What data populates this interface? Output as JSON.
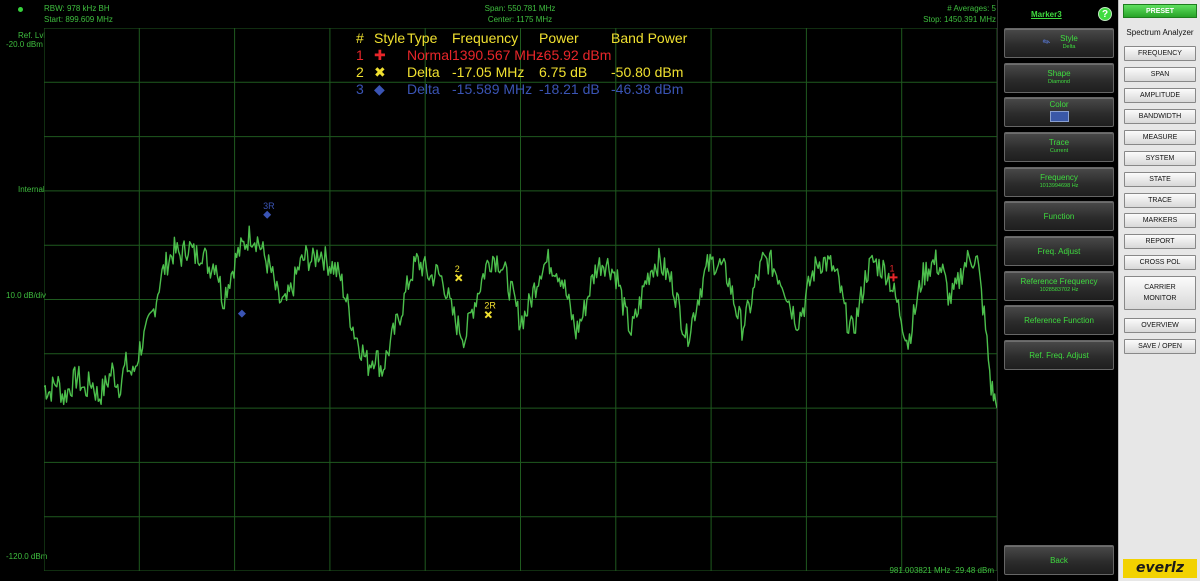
{
  "header": {
    "rbw": "RBW: 978 kHz BH",
    "start": "Start: 899.609 MHz",
    "span": "Span: 550.781 MHz",
    "center": "Center: 1175 MHz",
    "averages": "# Averages: 5",
    "stop": "Stop: 1450.391 MHz"
  },
  "y_axis": {
    "ref_label": "Ref. Lvl",
    "ref_value": "-20.0 dBm",
    "internal": "Internal",
    "scale": "10.0 dB/div",
    "bottom": "-120.0 dBm"
  },
  "readout": "981.003821 MHz -29.48 dBm",
  "marker_table": {
    "headers": [
      "#",
      "Style",
      "Type",
      "Frequency",
      "Power",
      "Band Power"
    ],
    "rows": [
      {
        "num": "1",
        "symbol": "✚",
        "type": "Normal",
        "frequency": "1390.567 MHz",
        "power": "-65.92 dBm",
        "band_power": "",
        "color": "#e8262a"
      },
      {
        "num": "2",
        "symbol": "✖",
        "type": "Delta",
        "frequency": "-17.05 MHz",
        "power": "6.75 dB",
        "band_power": "-50.80 dBm",
        "color": "#f0e030"
      },
      {
        "num": "3",
        "symbol": "◆",
        "type": "Delta",
        "frequency": "-15.589 MHz",
        "power": "-18.21 dB",
        "band_power": "-46.38 dBm",
        "color": "#3a54b4"
      }
    ]
  },
  "plot_markers": {
    "m1": "1",
    "m2": "2",
    "m2r": "2R",
    "m3r": "3R"
  },
  "marker_panel": {
    "title": "Marker3",
    "help": "?",
    "style": {
      "label": "Style",
      "value": "Delta",
      "icon": "marker-style-icon"
    },
    "shape": {
      "label": "Shape",
      "value": "Diamond"
    },
    "color": {
      "label": "Color",
      "swatch": "#3a58a8"
    },
    "trace": {
      "label": "Trace",
      "value": "Current"
    },
    "frequency": {
      "label": "Frequency",
      "value": "1013994698 Hz"
    },
    "function": "Function",
    "freq_adjust": "Freq. Adjust",
    "ref_frequency": {
      "label": "Reference Frequency",
      "value": "1028583702 Hz"
    },
    "ref_function": "Reference Function",
    "ref_freq_adjust": "Ref. Freq. Adjust",
    "back": "Back"
  },
  "menu": {
    "preset": "PRESET",
    "title": "Spectrum Analyzer",
    "items": [
      "FREQUENCY",
      "SPAN",
      "AMPLITUDE",
      "BANDWIDTH",
      "MEASURE",
      "SYSTEM",
      "STATE",
      "TRACE",
      "MARKERS",
      "REPORT",
      "CROSS POL",
      "CARRIER\nMONITOR",
      "OVERVIEW",
      "SAVE / OPEN"
    ],
    "logo": "everlz"
  },
  "colors": {
    "trace": "#4cbf4c",
    "grid": "#1f5a1f",
    "text": "#3fbf3f",
    "marker1": "#e8262a",
    "marker2": "#f0e030",
    "marker3": "#3a54b4"
  },
  "chart_data": {
    "type": "line",
    "title": "",
    "xlabel": "",
    "ylabel": "",
    "x_unit": "MHz",
    "y_unit": "dBm",
    "xlim": [
      899.609,
      1450.391
    ],
    "ylim": [
      -120,
      -20
    ],
    "grid": true,
    "series": [
      {
        "x": [
          899.6,
          903,
          907,
          911,
          915,
          919,
          923,
          927,
          931,
          935,
          939,
          943,
          947,
          951,
          955,
          959,
          963,
          967,
          971,
          975,
          979,
          983,
          987,
          991,
          995,
          999,
          1003,
          1007,
          1011,
          1015,
          1019,
          1023,
          1027,
          1031,
          1035,
          1039,
          1043,
          1047,
          1051,
          1055,
          1059,
          1063,
          1067,
          1071,
          1075,
          1079,
          1083,
          1087,
          1091,
          1095,
          1099,
          1103,
          1107,
          1111,
          1115,
          1119,
          1123,
          1127,
          1131,
          1135,
          1139,
          1143,
          1147,
          1151,
          1155,
          1159,
          1163,
          1167,
          1171,
          1175,
          1179,
          1183,
          1187,
          1191,
          1195,
          1199,
          1203,
          1207,
          1211,
          1215,
          1219,
          1223,
          1227,
          1231,
          1235,
          1239,
          1243,
          1247,
          1251,
          1255,
          1259,
          1263,
          1267,
          1271,
          1275,
          1279,
          1283,
          1287,
          1291,
          1295,
          1299,
          1303,
          1307,
          1311,
          1315,
          1319,
          1323,
          1327,
          1331,
          1335,
          1339,
          1343,
          1347,
          1351,
          1355,
          1359,
          1363,
          1367,
          1371,
          1375,
          1379,
          1383,
          1387,
          1391,
          1395,
          1399,
          1403,
          1407,
          1411,
          1415,
          1419,
          1423,
          1427,
          1431,
          1435,
          1439,
          1443,
          1447,
          1450.4
        ],
        "y": [
          -86,
          -87,
          -85,
          -88,
          -86,
          -84,
          -87,
          -85,
          -88,
          -86,
          -83,
          -86,
          -82,
          -84,
          -79,
          -76,
          -72,
          -66,
          -63,
          -61,
          -62,
          -60,
          -62,
          -61,
          -64,
          -63,
          -70,
          -66,
          -62,
          -60,
          -58,
          -59,
          -62,
          -65,
          -70,
          -71,
          -68,
          -64,
          -62,
          -63,
          -61,
          -63,
          -64,
          -66,
          -71,
          -76,
          -79,
          -82,
          -80,
          -83,
          -79,
          -75,
          -71,
          -66,
          -63,
          -64,
          -66,
          -65,
          -67,
          -72,
          -75,
          -77,
          -72,
          -68,
          -64,
          -62,
          -63,
          -66,
          -70,
          -74,
          -72,
          -68,
          -64,
          -63,
          -64,
          -66,
          -71,
          -76,
          -73,
          -68,
          -64,
          -63,
          -64,
          -66,
          -72,
          -76,
          -72,
          -67,
          -64,
          -63,
          -65,
          -67,
          -72,
          -77,
          -73,
          -68,
          -64,
          -63,
          -64,
          -66,
          -71,
          -75,
          -72,
          -67,
          -63,
          -63,
          -65,
          -67,
          -71,
          -74,
          -71,
          -66,
          -63,
          -63,
          -64,
          -67,
          -73,
          -76,
          -71,
          -65,
          -63,
          -64,
          -65,
          -69,
          -73,
          -78,
          -72,
          -66,
          -64,
          -63,
          -65,
          -70,
          -68,
          -64,
          -62,
          -63,
          -73,
          -86,
          -90
        ]
      }
    ],
    "markers": [
      {
        "label": "1",
        "type": "Normal",
        "frequency_mhz": 1390.567,
        "power_dbm": -65.92
      },
      {
        "label": "2",
        "type": "Delta",
        "frequency_mhz": 1139.3,
        "power_dbm": -66.0
      },
      {
        "label": "2R",
        "type": "Reference",
        "frequency_mhz": 1156.4,
        "power_dbm": -72.8
      },
      {
        "label": "3",
        "type": "Delta",
        "frequency_mhz": 1013.995,
        "power_dbm": -72.6
      },
      {
        "label": "3R",
        "type": "Reference",
        "frequency_mhz": 1028.584,
        "power_dbm": -54.4
      }
    ]
  }
}
